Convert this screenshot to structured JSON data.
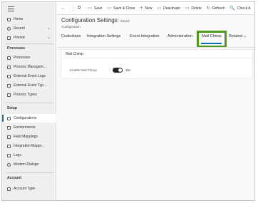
{
  "sidebar": {
    "top_items": [
      {
        "label": "Home",
        "icon": "home-icon"
      },
      {
        "label": "Recent",
        "icon": "clock-icon",
        "chevron": "⌄"
      },
      {
        "label": "Pinned",
        "icon": "pin-icon",
        "chevron": "⌄"
      }
    ],
    "sections": [
      {
        "title": "Processes",
        "items": [
          {
            "label": "Processes",
            "icon": "process-icon"
          },
          {
            "label": "Process Managem...",
            "icon": "process-management-icon"
          },
          {
            "label": "External Event Logs",
            "icon": "event-log-icon"
          },
          {
            "label": "External Event Typ...",
            "icon": "event-type-icon"
          },
          {
            "label": "Process Types",
            "icon": "process-type-icon"
          }
        ]
      },
      {
        "title": "Setup",
        "items": [
          {
            "label": "Configurations",
            "icon": "configuration-icon",
            "selected": true
          },
          {
            "label": "Environments",
            "icon": "environment-icon"
          },
          {
            "label": "Field Mappings",
            "icon": "field-mapping-icon"
          },
          {
            "label": "Integration Mappi...",
            "icon": "integration-mapping-icon"
          },
          {
            "label": "Logs",
            "icon": "log-icon"
          },
          {
            "label": "Modern Dialogs",
            "icon": "dialog-icon"
          }
        ]
      },
      {
        "title": "Account",
        "items": [
          {
            "label": "Account Type",
            "icon": "account-type-icon"
          }
        ]
      }
    ]
  },
  "commandbar": {
    "back_glyph": "←",
    "popout_glyph": "⧉",
    "buttons": [
      {
        "label": "Save",
        "glyph": "▭"
      },
      {
        "label": "Save & Close",
        "glyph": "▭"
      },
      {
        "label": "New",
        "glyph": "+"
      },
      {
        "label": "Deactivate",
        "glyph": "▭"
      },
      {
        "label": "Delete",
        "glyph": "▭"
      },
      {
        "label": "Refresh",
        "glyph": "↻"
      },
      {
        "label": "Check A",
        "glyph": "🔍"
      }
    ]
  },
  "header": {
    "title": "Configuration Settings",
    "saved_status": "- Saved",
    "entity": "Configuration"
  },
  "tabs": [
    {
      "label": "Custodians"
    },
    {
      "label": "Integration Settings"
    },
    {
      "label": "Event Integration"
    },
    {
      "label": "Administration"
    },
    {
      "label": "Mail Chimp",
      "active": true
    },
    {
      "label": "Related ⌄"
    }
  ],
  "section": {
    "title": "Mail Chimp",
    "field_label": "Enable Mail Chimp",
    "toggle_value_label": "Yes",
    "toggle_on": true
  },
  "colors": {
    "accent": "#106ebe",
    "highlight_box": "#4e9a1c",
    "toggle_on": "#252423"
  }
}
